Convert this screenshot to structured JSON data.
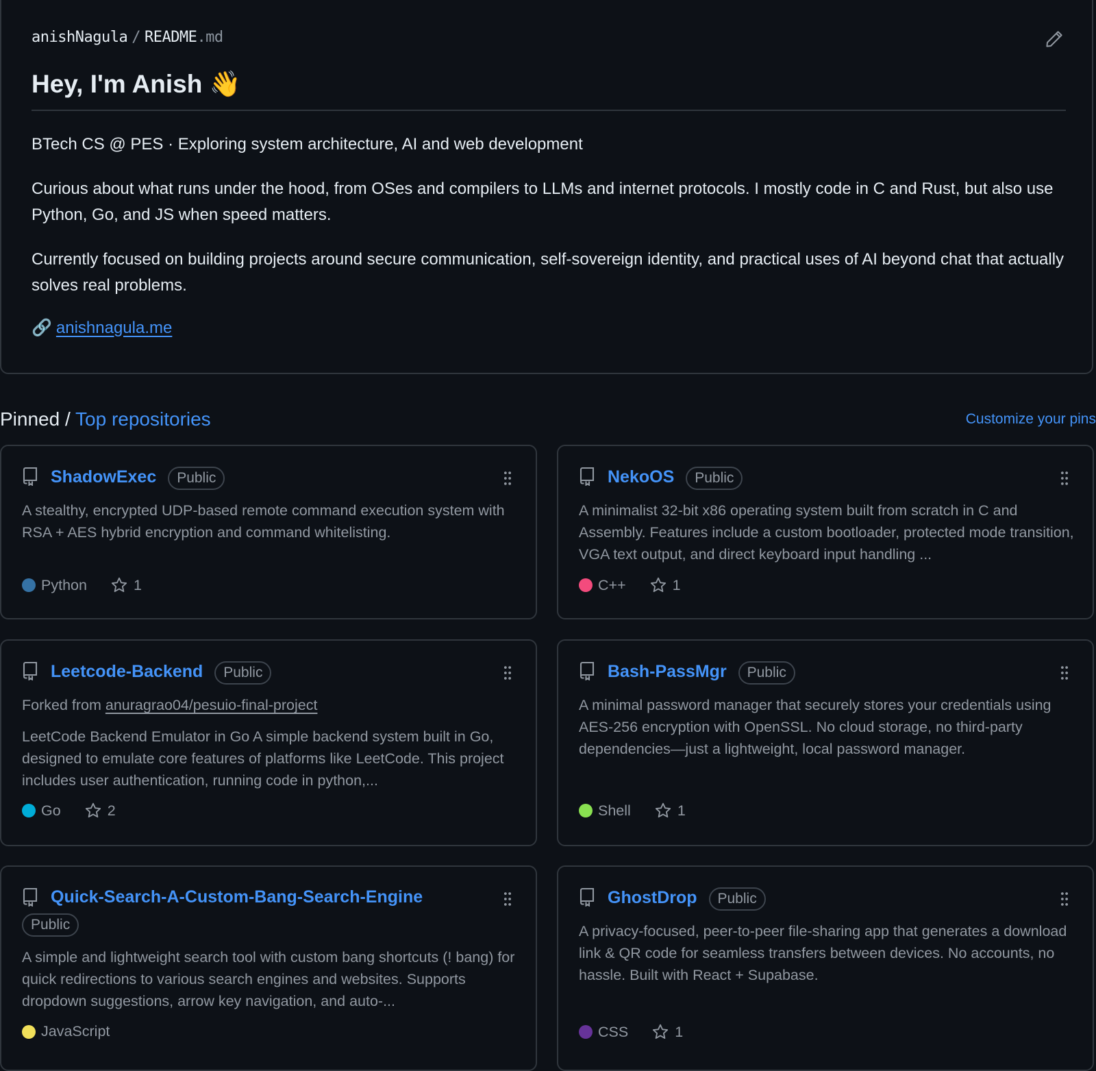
{
  "readme": {
    "owner": "anishNagula",
    "separator": "/",
    "file_base": "README",
    "file_ext": ".md",
    "title": "Hey, I'm Anish 👋",
    "paragraph1": "BTech CS @ PES · Exploring system architecture, AI and web development",
    "paragraph2": "Curious about what runs under the hood, from OSes and compilers to LLMs and internet protocols. I mostly code in C and Rust, but also use Python, Go, and JS when speed matters.",
    "paragraph3": "Currently focused on building projects around secure communication, self-sovereign identity, and practical uses of AI beyond chat that actually solves real problems.",
    "link_emoji": "🔗",
    "link_text": "anishnagula.me"
  },
  "pinned": {
    "label": "Pinned",
    "separator": " / ",
    "accent": "Top repositories",
    "customize": "Customize your pins"
  },
  "repos": [
    {
      "name": "ShadowExec",
      "badge": "Public",
      "description": "A stealthy, encrypted UDP-based remote command execution system with RSA + AES hybrid encryption and command whitelisting.",
      "language": "Python",
      "lang_color": "#3572A5",
      "stars": "1"
    },
    {
      "name": "NekoOS",
      "badge": "Public",
      "description": "A minimalist 32-bit x86 operating system built from scratch in C and Assembly. Features include a custom bootloader, protected mode transition, VGA text output, and direct keyboard input handling ...",
      "language": "C++",
      "lang_color": "#f34b7d",
      "stars": "1"
    },
    {
      "name": "Leetcode-Backend",
      "badge": "Public",
      "forked_prefix": "Forked from ",
      "forked_from": "anuragrao04/pesuio-final-project",
      "description": "LeetCode Backend Emulator in Go A simple backend system built in Go, designed to emulate core features of platforms like LeetCode. This project includes user authentication, running code in python,...",
      "language": "Go",
      "lang_color": "#00ADD8",
      "stars": "2"
    },
    {
      "name": "Bash-PassMgr",
      "badge": "Public",
      "description": "A minimal password manager that securely stores your credentials using AES-256 encryption with OpenSSL. No cloud storage, no third-party dependencies—just a lightweight, local password manager.",
      "language": "Shell",
      "lang_color": "#89e051",
      "stars": "1"
    },
    {
      "name": "Quick-Search-A-Custom-Bang-Search-Engine",
      "badge": "Public",
      "description": "A simple and lightweight search tool with custom bang shortcuts (! bang) for quick redirections to various search engines and websites. Supports dropdown suggestions, arrow key navigation, and auto-...",
      "language": "JavaScript",
      "lang_color": "#f1e05a",
      "stars": ""
    },
    {
      "name": "GhostDrop",
      "badge": "Public",
      "description": "A privacy-focused, peer-to-peer file-sharing app that generates a download link & QR code for seamless transfers between devices. No accounts, no hassle. Built with React + Supabase.",
      "language": "CSS",
      "lang_color": "#663399",
      "stars": "1"
    }
  ]
}
